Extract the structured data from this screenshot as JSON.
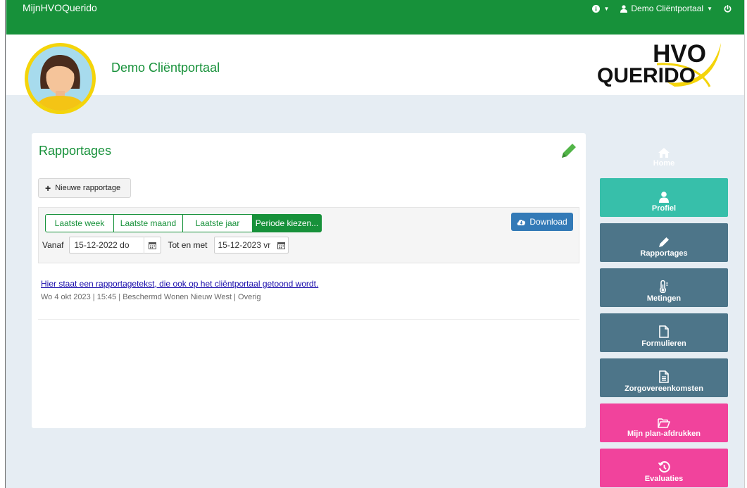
{
  "topnav": {
    "brand": "MijnHVOQuerido",
    "user_label": "Demo Cliëntportaal"
  },
  "header": {
    "client_name": "Demo Cliëntportaal",
    "logo_line1": "HVO",
    "logo_line2": "QUERIDO"
  },
  "card": {
    "title": "Rapportages",
    "new_button": "Nieuwe rapportage",
    "periods": [
      {
        "label": "Laatste week",
        "active": false
      },
      {
        "label": "Laatste maand",
        "active": false
      },
      {
        "label": "Laatste jaar",
        "active": false
      },
      {
        "label": "Periode kiezen...",
        "active": true
      }
    ],
    "download_label": "Download",
    "from_label": "Vanaf",
    "from_value": "15-12-2022 do",
    "to_label": "Tot en met",
    "to_value": "15-12-2023 vr"
  },
  "report": {
    "text": "Hier staat een rapportagetekst, die ook op het cliëntportaal getoond wordt.",
    "meta": "Wo 4 okt 2023 | 15:45 | Beschermd Wonen Nieuw West | Overig"
  },
  "tiles": [
    {
      "label": "Home",
      "icon": "home-icon"
    },
    {
      "label": "Profiel",
      "icon": "user-icon"
    },
    {
      "label": "Rapportages",
      "icon": "pencil-icon"
    },
    {
      "label": "Metingen",
      "icon": "thermometer-icon"
    },
    {
      "label": "Formulieren",
      "icon": "file-icon"
    },
    {
      "label": "Zorgovereenkomsten",
      "icon": "file-text-icon"
    },
    {
      "label": "Mijn plan-afdrukken",
      "icon": "folder-open-icon"
    },
    {
      "label": "Evaluaties",
      "icon": "history-icon"
    }
  ],
  "colors": {
    "brand_green": "#17913a",
    "teal": "#37bfaa",
    "slate": "#4d7589",
    "pink": "#f1439c",
    "download_blue": "#337ab7"
  }
}
